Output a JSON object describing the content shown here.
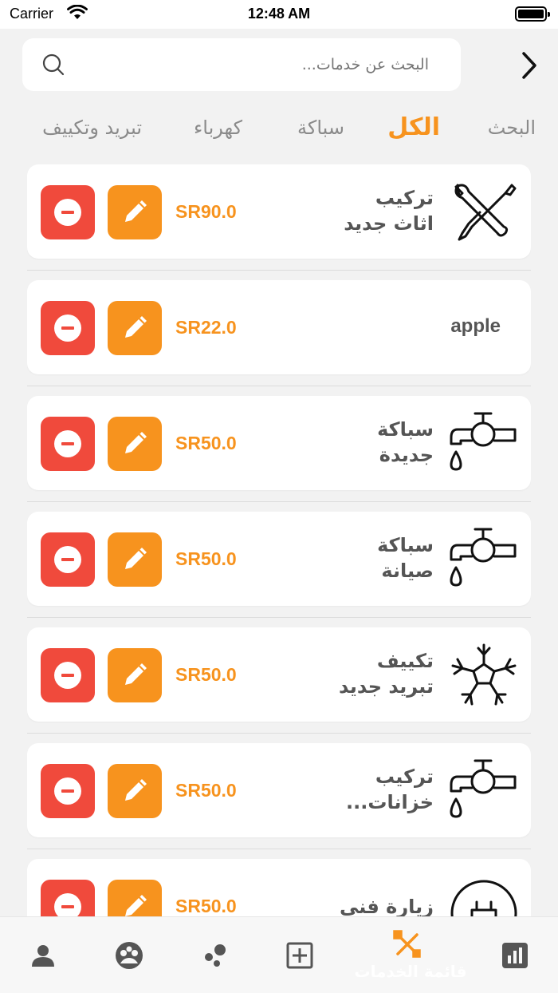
{
  "status_bar": {
    "carrier": "Carrier",
    "time": "12:48 AM"
  },
  "search": {
    "placeholder": "البحث عن خدمات..."
  },
  "tabs": [
    {
      "label": "البحث",
      "active": false
    },
    {
      "label": "الكل",
      "active": true
    },
    {
      "label": "سباكة",
      "active": false
    },
    {
      "label": "كهرباء",
      "active": false
    },
    {
      "label": "تبريد وتكييف",
      "active": false
    }
  ],
  "services": [
    {
      "line1": "تركيب",
      "line2": "اثاث جديد",
      "price": "SR90.0",
      "icon": "tools-icon"
    },
    {
      "line1": "apple",
      "line2": "",
      "price": "SR22.0",
      "icon": ""
    },
    {
      "line1": "سباكة",
      "line2": "جديدة",
      "price": "SR50.0",
      "icon": "faucet-icon"
    },
    {
      "line1": "سباكة",
      "line2": "صيانة",
      "price": "SR50.0",
      "icon": "faucet-icon"
    },
    {
      "line1": "تكييف",
      "line2": "تبريد جديد",
      "price": "SR50.0",
      "icon": "snowflake-icon"
    },
    {
      "line1": "تركيب",
      "line2": "خزانات...",
      "price": "SR50.0",
      "icon": "faucet-icon"
    },
    {
      "line1": "زيارة فني",
      "line2": "",
      "price": "SR50.0",
      "icon": "plug-icon"
    }
  ],
  "bottom_nav": {
    "active_label": "قائمة الخدمات",
    "items": [
      "profile-icon",
      "group-icon",
      "bubbles-icon",
      "add-square-icon",
      "services-list-icon",
      "stats-icon"
    ]
  },
  "colors": {
    "accent": "#f7931e",
    "danger": "#f04a3c",
    "background": "#f2f2f2"
  }
}
